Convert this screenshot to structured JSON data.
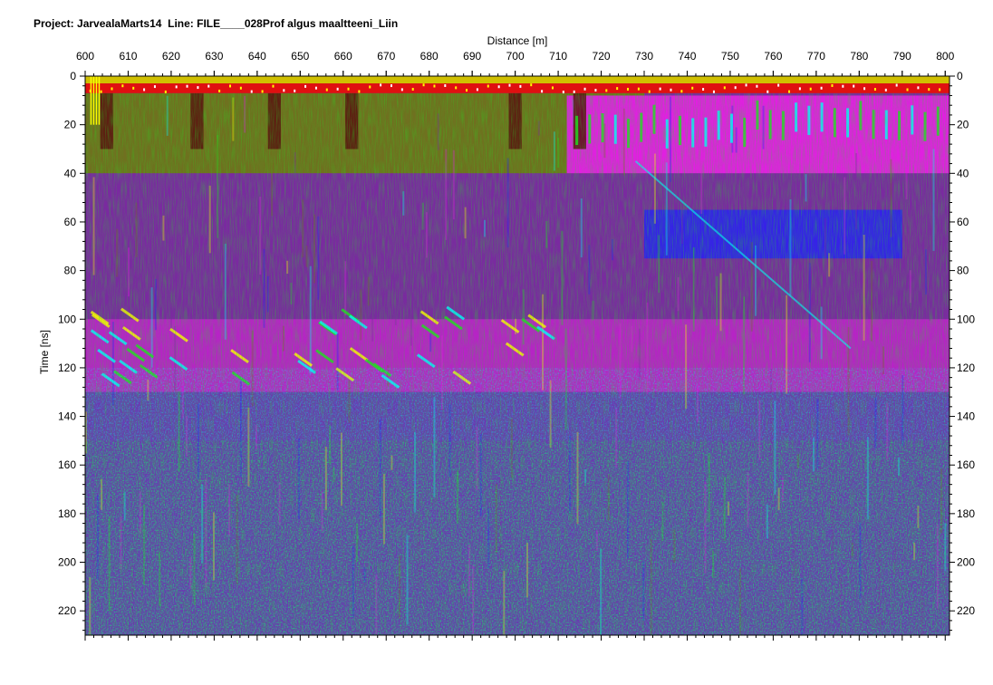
{
  "header": {
    "project_label": "Project:",
    "project_name": "JarvealaMarts14",
    "line_label": "Line:",
    "line_name": "FILE____028Prof algus maaltteeni_Liin"
  },
  "chart_data": {
    "type": "heatmap",
    "title": "",
    "xlabel": "Distance [m]",
    "ylabel": "Time [ns]",
    "xlim": [
      600,
      801
    ],
    "ylim": [
      0,
      230
    ],
    "y_inverted": true,
    "x_ticks": [
      600,
      610,
      620,
      630,
      640,
      650,
      660,
      670,
      680,
      690,
      700,
      710,
      720,
      730,
      740,
      750,
      760,
      770,
      780,
      790,
      800
    ],
    "y_ticks": [
      0,
      20,
      40,
      60,
      80,
      100,
      120,
      140,
      160,
      180,
      200,
      220
    ],
    "x_axis_position": "top",
    "y_axes": "left-and-right",
    "grid": false,
    "colormap": "multicolor radargram (red, yellow, green, cyan, blue, magenta, purple, dark red)",
    "colors": {
      "surface_band": "#e01010",
      "strong_reflection": "#ffff00",
      "green": "#20e020",
      "cyan": "#00ffff",
      "blue": "#2020ff",
      "magenta": "#e020e0",
      "purple": "#7a2aa0",
      "dark_red": "#5a1010",
      "olive": "#707020"
    },
    "features": [
      {
        "label": "surface reflection band",
        "x": [
          600,
          801
        ],
        "y": [
          0,
          7
        ]
      },
      {
        "label": "dark red vertical columns",
        "x": [
          600,
          730
        ],
        "y": [
          7,
          30
        ]
      },
      {
        "label": "cyan / magenta upper zone",
        "x": [
          712,
          801
        ],
        "y": [
          8,
          40
        ]
      },
      {
        "label": "purple layer",
        "x": [
          600,
          801
        ],
        "y": [
          40,
          100
        ]
      },
      {
        "label": "blue band",
        "x": [
          730,
          790
        ],
        "y": [
          55,
          75
        ]
      },
      {
        "label": "dipping reflections",
        "x": [
          600,
          715
        ],
        "y": [
          95,
          130
        ]
      },
      {
        "label": "noise",
        "x": [
          600,
          801
        ],
        "y": [
          130,
          230
        ]
      }
    ]
  }
}
